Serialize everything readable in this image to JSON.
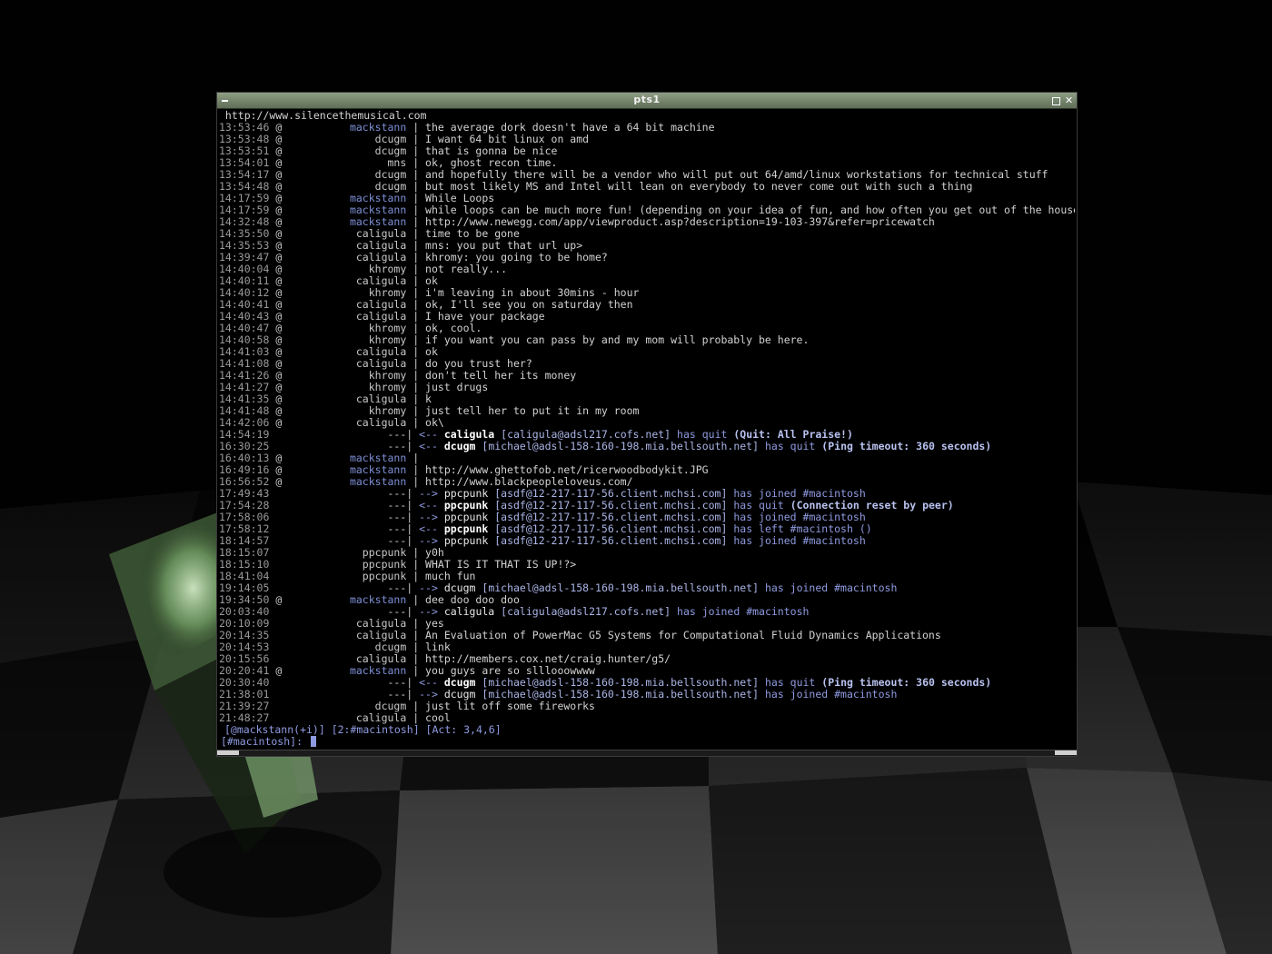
{
  "window": {
    "title": "pts1"
  },
  "log": [
    {
      "type": "raw",
      "text": " http://www.silencethemusical.com"
    },
    {
      "type": "msg",
      "time": "13:53:46",
      "mode": "@",
      "nick": "mackstann",
      "op": true,
      "text": "the average dork doesn't have a 64 bit machine"
    },
    {
      "type": "msg",
      "time": "13:53:48",
      "mode": "@",
      "nick": "dcugm",
      "op": false,
      "text": "I want 64 bit linux on amd"
    },
    {
      "type": "msg",
      "time": "13:53:51",
      "mode": "@",
      "nick": "dcugm",
      "op": false,
      "text": "that is gonna be nice"
    },
    {
      "type": "msg",
      "time": "13:54:01",
      "mode": "@",
      "nick": "mns",
      "op": false,
      "text": "ok, ghost recon time."
    },
    {
      "type": "msg",
      "time": "13:54:17",
      "mode": "@",
      "nick": "dcugm",
      "op": false,
      "text": "and hopefully there will be a vendor who will put out 64/amd/linux workstations for technical stuff"
    },
    {
      "type": "msg",
      "time": "13:54:48",
      "mode": "@",
      "nick": "dcugm",
      "op": false,
      "text": "but most likely MS and Intel will lean on everybody to never come out with such a thing"
    },
    {
      "type": "msg",
      "time": "14:17:59",
      "mode": "@",
      "nick": "mackstann",
      "op": true,
      "text": "While Loops"
    },
    {
      "type": "msg",
      "time": "14:17:59",
      "mode": "@",
      "nick": "mackstann",
      "op": true,
      "text": "while loops can be much more fun! (depending on your idea of fun, and how often you get out of the house... )"
    },
    {
      "type": "msg",
      "time": "14:32:48",
      "mode": "@",
      "nick": "mackstann",
      "op": true,
      "text": "http://www.newegg.com/app/viewproduct.asp?description=19-103-397&refer=pricewatch"
    },
    {
      "type": "msg",
      "time": "14:35:50",
      "mode": "@",
      "nick": "caligula",
      "op": false,
      "text": "time to be gone"
    },
    {
      "type": "msg",
      "time": "14:35:53",
      "mode": "@",
      "nick": "caligula",
      "op": false,
      "text": "mns: you put that url up>"
    },
    {
      "type": "msg",
      "time": "14:39:47",
      "mode": "@",
      "nick": "caligula",
      "op": false,
      "text": "khromy: you going to be home?"
    },
    {
      "type": "msg",
      "time": "14:40:04",
      "mode": "@",
      "nick": "khromy",
      "op": false,
      "text": "not really..."
    },
    {
      "type": "msg",
      "time": "14:40:11",
      "mode": "@",
      "nick": "caligula",
      "op": false,
      "text": "ok"
    },
    {
      "type": "msg",
      "time": "14:40:12",
      "mode": "@",
      "nick": "khromy",
      "op": false,
      "text": "i'm leaving in about 30mins - hour"
    },
    {
      "type": "msg",
      "time": "14:40:41",
      "mode": "@",
      "nick": "caligula",
      "op": false,
      "text": "ok, I'll see you on saturday then"
    },
    {
      "type": "msg",
      "time": "14:40:43",
      "mode": "@",
      "nick": "caligula",
      "op": false,
      "text": "I have your package"
    },
    {
      "type": "msg",
      "time": "14:40:47",
      "mode": "@",
      "nick": "khromy",
      "op": false,
      "text": "ok, cool."
    },
    {
      "type": "msg",
      "time": "14:40:58",
      "mode": "@",
      "nick": "khromy",
      "op": false,
      "text": "if you want you can pass by and my mom will probably be here."
    },
    {
      "type": "msg",
      "time": "14:41:03",
      "mode": "@",
      "nick": "caligula",
      "op": false,
      "text": "ok"
    },
    {
      "type": "msg",
      "time": "14:41:08",
      "mode": "@",
      "nick": "caligula",
      "op": false,
      "text": "do you trust her?"
    },
    {
      "type": "msg",
      "time": "14:41:26",
      "mode": "@",
      "nick": "khromy",
      "op": false,
      "text": "don't tell her its money"
    },
    {
      "type": "msg",
      "time": "14:41:27",
      "mode": "@",
      "nick": "khromy",
      "op": false,
      "text": "just drugs"
    },
    {
      "type": "msg",
      "time": "14:41:35",
      "mode": "@",
      "nick": "caligula",
      "op": false,
      "text": "k"
    },
    {
      "type": "msg",
      "time": "14:41:48",
      "mode": "@",
      "nick": "khromy",
      "op": false,
      "text": "just tell her to put it in my room"
    },
    {
      "type": "msg",
      "time": "14:42:06",
      "mode": "@",
      "nick": "caligula",
      "op": false,
      "text": "ok\\"
    },
    {
      "type": "event",
      "time": "14:54:19",
      "arrow": "<--",
      "nick": "caligula",
      "bold": true,
      "host": "[caligula@adsl217.cofs.net]",
      "action": "has quit",
      "reason": "(Quit: All Praise!)"
    },
    {
      "type": "event",
      "time": "16:30:25",
      "arrow": "<--",
      "nick": "dcugm",
      "bold": true,
      "host": "[michael@adsl-158-160-198.mia.bellsouth.net]",
      "action": "has quit",
      "reason": "(Ping timeout: 360 seconds)"
    },
    {
      "type": "msg",
      "time": "16:40:13",
      "mode": "@",
      "nick": "mackstann",
      "op": true,
      "text": ""
    },
    {
      "type": "msg",
      "time": "16:49:16",
      "mode": "@",
      "nick": "mackstann",
      "op": true,
      "text": "http://www.ghettofob.net/ricerwoodbodykit.JPG"
    },
    {
      "type": "msg",
      "time": "16:56:52",
      "mode": "@",
      "nick": "mackstann",
      "op": true,
      "text": "http://www.blackpeopleloveus.com/"
    },
    {
      "type": "event",
      "time": "17:49:43",
      "arrow": "-->",
      "nick": "ppcpunk",
      "bold": false,
      "host": "[asdf@12-217-117-56.client.mchsi.com]",
      "action": "has joined #macintosh",
      "reason": ""
    },
    {
      "type": "event",
      "time": "17:54:28",
      "arrow": "<--",
      "nick": "ppcpunk",
      "bold": true,
      "host": "[asdf@12-217-117-56.client.mchsi.com]",
      "action": "has quit",
      "reason": "(Connection reset by peer)"
    },
    {
      "type": "event",
      "time": "17:58:06",
      "arrow": "-->",
      "nick": "ppcpunk",
      "bold": false,
      "host": "[asdf@12-217-117-56.client.mchsi.com]",
      "action": "has joined #macintosh",
      "reason": ""
    },
    {
      "type": "event",
      "time": "17:58:12",
      "arrow": "<--",
      "nick": "ppcpunk",
      "bold": true,
      "host": "[asdf@12-217-117-56.client.mchsi.com]",
      "action": "has left #macintosh ()",
      "reason": ""
    },
    {
      "type": "event",
      "time": "18:14:57",
      "arrow": "-->",
      "nick": "ppcpunk",
      "bold": false,
      "host": "[asdf@12-217-117-56.client.mchsi.com]",
      "action": "has joined #macintosh",
      "reason": ""
    },
    {
      "type": "msg",
      "time": "18:15:07",
      "mode": " ",
      "nick": "ppcpunk",
      "op": false,
      "text": "y0h"
    },
    {
      "type": "msg",
      "time": "18:15:10",
      "mode": " ",
      "nick": "ppcpunk",
      "op": false,
      "text": "WHAT IS IT THAT IS UP!?>"
    },
    {
      "type": "msg",
      "time": "18:41:04",
      "mode": " ",
      "nick": "ppcpunk",
      "op": false,
      "text": "much fun"
    },
    {
      "type": "event",
      "time": "19:14:05",
      "arrow": "-->",
      "nick": "dcugm",
      "bold": false,
      "host": "[michael@adsl-158-160-198.mia.bellsouth.net]",
      "action": "has joined #macintosh",
      "reason": ""
    },
    {
      "type": "msg",
      "time": "19:34:50",
      "mode": "@",
      "nick": "mackstann",
      "op": true,
      "text": "dee doo doo doo"
    },
    {
      "type": "event",
      "time": "20:03:40",
      "arrow": "-->",
      "nick": "caligula",
      "bold": false,
      "host": "[caligula@adsl217.cofs.net]",
      "action": "has joined #macintosh",
      "reason": ""
    },
    {
      "type": "msg",
      "time": "20:10:09",
      "mode": " ",
      "nick": "caligula",
      "op": false,
      "text": "yes"
    },
    {
      "type": "msg",
      "time": "20:14:35",
      "mode": " ",
      "nick": "caligula",
      "op": false,
      "text": "An Evaluation of PowerMac G5 Systems for Computational Fluid Dynamics Applications"
    },
    {
      "type": "msg",
      "time": "20:14:53",
      "mode": " ",
      "nick": "dcugm",
      "op": false,
      "text": "link"
    },
    {
      "type": "msg",
      "time": "20:15:56",
      "mode": " ",
      "nick": "caligula",
      "op": false,
      "text": "http://members.cox.net/craig.hunter/g5/"
    },
    {
      "type": "msg",
      "time": "20:20:41",
      "mode": "@",
      "nick": "mackstann",
      "op": true,
      "text": "you guys are so slllooowwww"
    },
    {
      "type": "event",
      "time": "20:30:40",
      "arrow": "<--",
      "nick": "dcugm",
      "bold": true,
      "host": "[michael@adsl-158-160-198.mia.bellsouth.net]",
      "action": "has quit",
      "reason": "(Ping timeout: 360 seconds)"
    },
    {
      "type": "event",
      "time": "21:38:01",
      "arrow": "-->",
      "nick": "dcugm",
      "bold": false,
      "host": "[michael@adsl-158-160-198.mia.bellsouth.net]",
      "action": "has joined #macintosh",
      "reason": ""
    },
    {
      "type": "msg",
      "time": "21:39:27",
      "mode": " ",
      "nick": "dcugm",
      "op": false,
      "text": "just lit off some fireworks"
    },
    {
      "type": "msg",
      "time": "21:48:27",
      "mode": " ",
      "nick": "caligula",
      "op": false,
      "text": "cool"
    }
  ],
  "status": {
    "text": "[@mackstann(+i)] [2:#macintosh] [Act: 3,4,6]"
  },
  "input": {
    "prompt": "[#macintosh]: ",
    "value": ""
  },
  "colors": {
    "op_nick": "#7d8fd6",
    "event": "#8f9ae0",
    "titlebar": "#6f7e67"
  }
}
